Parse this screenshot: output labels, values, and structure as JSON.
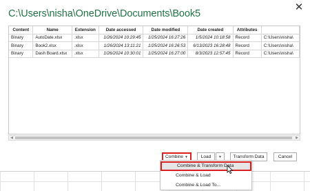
{
  "title": "C:\\Users\\nisha\\OneDrive\\Documents\\Book5",
  "close_glyph": "✕",
  "table": {
    "columns": [
      "Content",
      "Name",
      "Extension",
      "Date accessed",
      "Date modified",
      "Date created",
      "Attributes",
      ""
    ],
    "rows": [
      [
        "Binary",
        "AutoDate.xlsx",
        ".xlsx",
        "1/26/2024 10:29:45",
        "1/25/2024 16:27:26",
        "1/5/2024 10:18:58",
        "Record",
        "C:\\Users\\nisha\\"
      ],
      [
        "Binary",
        "Book2.xlsx",
        ".xlsx",
        "1/26/2024 13:11:21",
        "1/25/2024 16:26:53",
        "6/13/2023 16:28:48",
        "Record",
        "C:\\Users\\nisha\\"
      ],
      [
        "Binary",
        "Dash Board.xlsx",
        ".xlsx",
        "1/26/2024 10:30:01",
        "1/25/2024 16:27:00",
        "8/3/2023 12:57:45",
        "Record",
        "C:\\Users\\nisha\\"
      ]
    ]
  },
  "buttons": {
    "combine": "Combine",
    "load": "Load",
    "transform": "Transform Data",
    "cancel": "Cancel"
  },
  "menu": {
    "items": [
      "Combine & Transform Data",
      "Combine & Load",
      "Combine & Load To..."
    ]
  },
  "colors": {
    "title": "#217346",
    "highlight": "#d91f1f"
  }
}
